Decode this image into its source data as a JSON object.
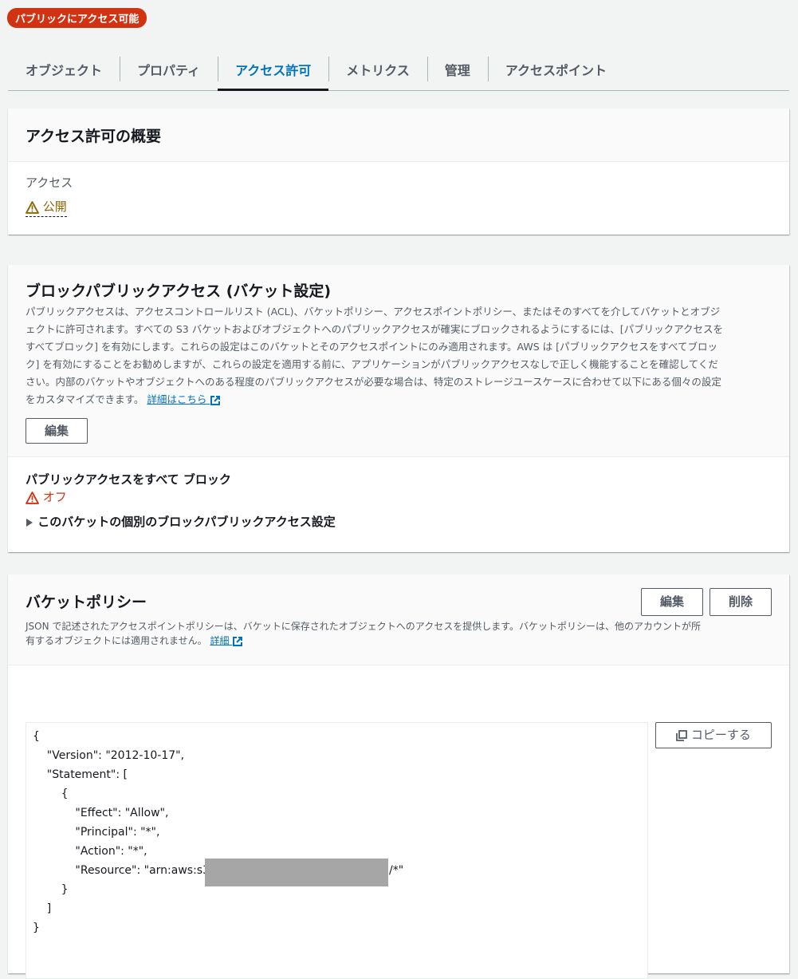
{
  "badge": "パブリックにアクセス可能",
  "tabs": [
    "オブジェクト",
    "プロパティ",
    "アクセス許可",
    "メトリクス",
    "管理",
    "アクセスポイント"
  ],
  "summary": {
    "title": "アクセス許可の概要",
    "access_label": "アクセス",
    "access_value": "公開"
  },
  "block": {
    "title": "ブロックパブリックアクセス (バケット設定)",
    "desc": [
      "パブリックアクセスは、アクセスコントロールリスト (ACL)、バケットポリシー、アクセスポイントポリシー、またはそのすべてを介してバケットとオブジ",
      "ェクトに許可されます。すべての S3 バケットおよびオブジェクトへのパブリックアクセスが確実にブロックされるようにするには、[パブリックアクセスを",
      "すべてブロック] を有効にします。これらの設定はこのバケットとそのアクセスポイントにのみ適用されます。AWS は [パブリックアクセスをすべてブロッ",
      "ク] を有効にすることをお勧めしますが、これらの設定を適用する前に、アプリケーションがパブリックアクセスなしで正しく機能することを確認してくだ",
      "さい。内部のバケットやオブジェクトへのある程度のパブリックアクセスが必要な場合は、特定のストレージユースケースに合わせて以下にある個々の設定",
      "をカスタマイズできます。"
    ],
    "learn_more": "詳細はこちら",
    "edit": "編集",
    "block_all_label": "パブリックアクセスをすべて ブロック",
    "block_all_value": "オフ",
    "individual": "このバケットの個別のブロックパブリックアクセス設定"
  },
  "policy": {
    "title": "バケットポリシー",
    "desc": [
      "JSON で記述されたアクセスポイントポリシーは、バケットに保存されたオブジェクトへのアクセスを提供します。バケットポリシーは、他のアカウントが所",
      "有するオブジェクトには適用されません。"
    ],
    "learn_more": "詳細",
    "edit": "編集",
    "delete": "削除",
    "copy": "コピーする",
    "code": [
      "{",
      "    \"Version\": \"2012-10-17\",",
      "    \"Statement\": [",
      "        {",
      "            \"Effect\": \"Allow\",",
      "            \"Principal\": \"*\",",
      "            \"Action\": \"*\",",
      "            \"Resource\": \"arn:aws:s3:::",
      "        }",
      "    ]",
      "}"
    ],
    "resource_suffix": "/*\""
  },
  "colors": {
    "badge": "#d13212",
    "active_tab": "#0073bb",
    "warning": "#8d6605",
    "error": "#d13212"
  },
  "icons": [
    "warning-icon",
    "error-icon",
    "external-link-icon",
    "caret-right-icon",
    "copy-icon"
  ]
}
